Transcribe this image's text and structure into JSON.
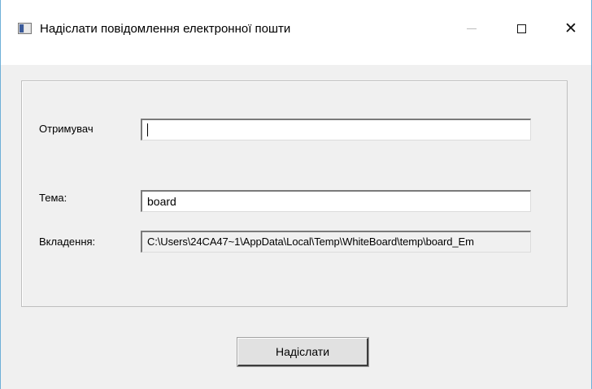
{
  "window": {
    "title": "Надіслати повідомлення електронної пошти"
  },
  "form": {
    "recipient_label": "Отримувач",
    "recipient_value": "",
    "subject_label": "Тема:",
    "subject_value": "board",
    "attachment_label": "Вкладення:",
    "attachment_value": "C:\\Users\\24CA47~1\\AppData\\Local\\Temp\\WhiteBoard\\temp\\board_Em"
  },
  "actions": {
    "send_label": "Надіслати"
  },
  "icons": {
    "app": "app-window-icon",
    "minimize": "minimize-icon",
    "maximize": "maximize-icon",
    "close": "close-icon"
  }
}
